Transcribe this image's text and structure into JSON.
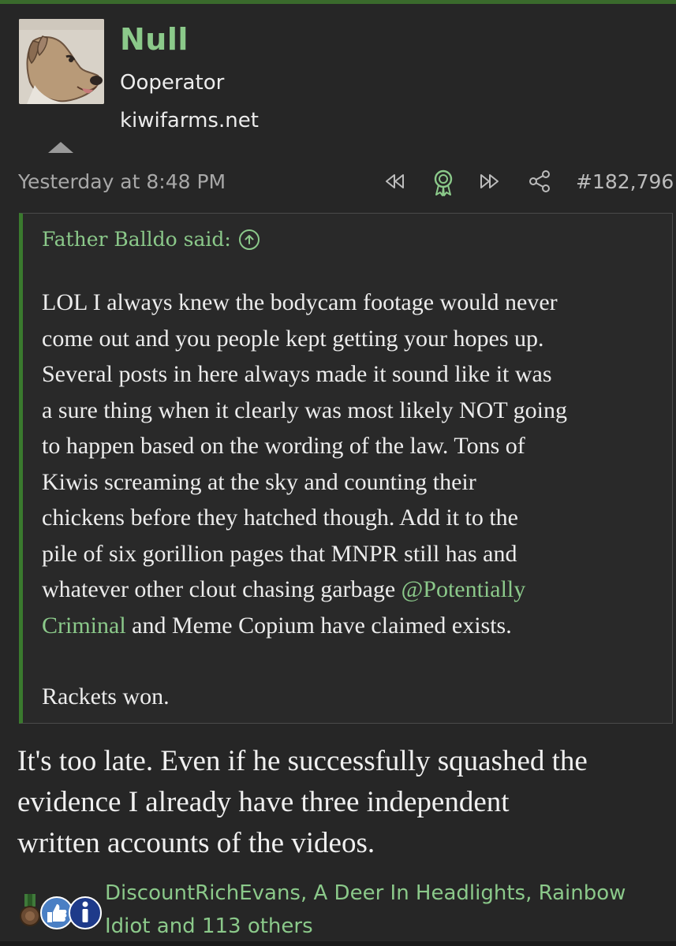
{
  "post": {
    "username": "Null",
    "user_title": "Ooperator",
    "site": "kiwifarms.net",
    "timestamp": "Yesterday at 8:48 PM",
    "post_number": "#182,796",
    "action_icons": [
      "rewind-icon",
      "award-icon",
      "fast-forward-icon",
      "share-icon"
    ]
  },
  "quote": {
    "attribution": "Father Balldo said:",
    "lines": [
      "LOL I always knew the bodycam footage would never",
      "come out and you people kept getting your hopes up.",
      "Several posts in here always made it sound like it was",
      "a sure thing when it clearly was most likely NOT going",
      "to happen based on the wording of the law. Tons of",
      "Kiwis screaming at the sky and counting their",
      "chickens before they hatched though. Add it to the",
      "pile of six gorillion pages that MNPR still has and"
    ],
    "line9_prefix": "whatever other clout chasing garbage ",
    "mention_part1": "@Potentially",
    "mention_part2": "Criminal",
    "line10_suffix": " and Meme Copium have claimed exists.",
    "closing": "Rackets won."
  },
  "reply": {
    "lines": [
      "It's too late. Even if he successfully squashed the",
      "evidence I already have three independent",
      "written accounts of the videos."
    ]
  },
  "reactions": {
    "icons": [
      "medal-icon",
      "thumbs-up-icon",
      "info-icon"
    ],
    "users_line1": "DiscountRichEvans, A Deer In Headlights, Rainbow",
    "users_line2": "Idiot and 113 others"
  },
  "colors": {
    "accent_green": "#8bc98a",
    "border_green": "#3a7a2e",
    "background": "#262626"
  }
}
